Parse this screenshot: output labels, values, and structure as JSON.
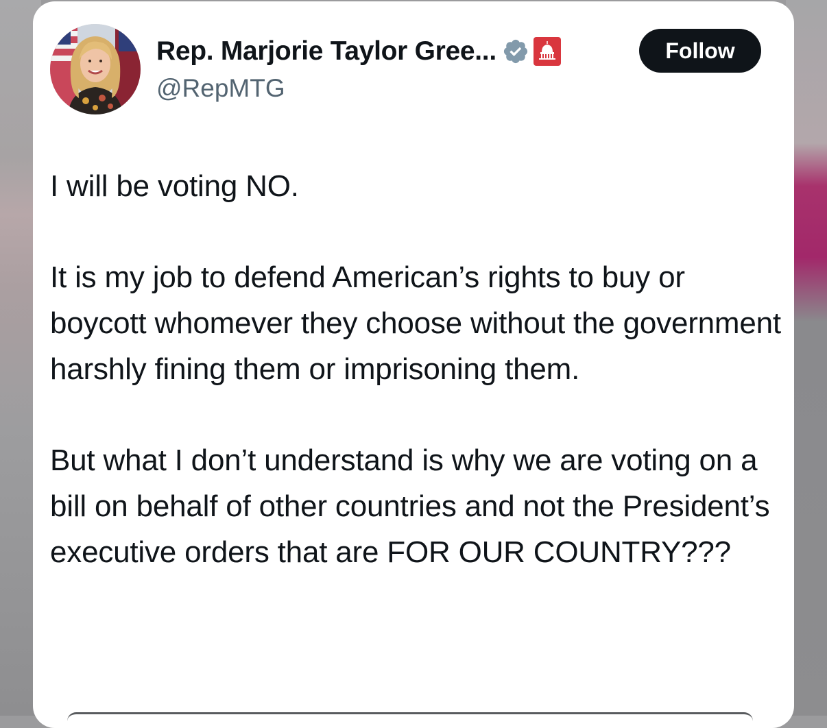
{
  "tweet": {
    "author": {
      "display_name": "Rep. Marjorie Taylor Gree...",
      "handle": "@RepMTG",
      "verified_icon": "verified-badge-gray",
      "affiliation_badge": "house-gop-capitol-badge",
      "affiliation_badge_color": "#d9363e"
    },
    "follow_button": {
      "label": "Follow"
    },
    "paragraphs": [
      "I will be voting NO.",
      "It is my job to defend American’s rights to buy or boycott whomever they choose without the government harshly fining them or imprisoning them.",
      "But what I don’t understand is why we are voting on a bill on behalf of other countries and not the President’s executive orders that are FOR OUR COUNTRY???"
    ]
  },
  "colors": {
    "text_primary": "#0f1419",
    "text_secondary": "#536471",
    "button_bg": "#0f1419",
    "button_text": "#ffffff",
    "verified_badge": "#829aab",
    "card_bg": "#ffffff"
  }
}
